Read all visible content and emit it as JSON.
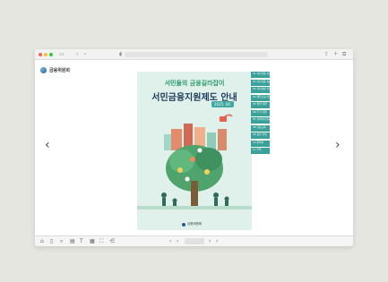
{
  "browser": {
    "icons": [
      "sidebar-icon",
      "back-icon",
      "forward-icon",
      "shield-icon",
      "share-icon",
      "new-tab-icon",
      "tabs-icon"
    ]
  },
  "brand": {
    "name": "금융위원회"
  },
  "cover": {
    "subtitle": "서민들의 금융길라잡이",
    "title": "서민금융지원제도 안내",
    "badge": "2025. 04.",
    "publisher": "금융위원회",
    "colors": {
      "background": "#dff1ea",
      "accent": "#2e9a6a",
      "title": "#1e3a5a"
    }
  },
  "toc": [
    "01 서민금융 지원제도",
    "02 서민금융 상품",
    "03 자산형성 지원",
    "04 채무조정 지원",
    "05 취업 지원",
    "06 주거 지원",
    "07 정책서민금융",
    "08 금융교육",
    "09 상담 안내",
    "10 문의처",
    "11 부록"
  ],
  "toolbar": {
    "icons": [
      "home-icon",
      "bookmark-icon",
      "search-icon",
      "print-icon",
      "text-icon",
      "thumbnail-icon",
      "fullscreen-icon",
      "share-icon"
    ],
    "prev": "‹",
    "next": "›"
  }
}
